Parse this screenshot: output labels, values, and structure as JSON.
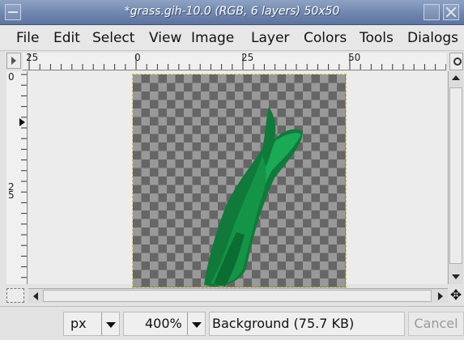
{
  "window": {
    "title": "*grass.gih-10.0 (RGB, 6 layers) 50x50"
  },
  "menubar": {
    "items": [
      "File",
      "Edit",
      "Select",
      "View",
      "Image",
      "Layer",
      "Colors",
      "Tools",
      "Dialogs"
    ]
  },
  "rulers": {
    "horizontal_labels": [
      "25",
      "0",
      "25",
      "50"
    ],
    "vertical_labels": [
      "0",
      "2\n5"
    ]
  },
  "canvas": {
    "checker_dark": "#666666",
    "checker_light": "#999999",
    "grass_colors": [
      "#0f7a3a",
      "#139446",
      "#1aa955",
      "#0c6d33"
    ]
  },
  "statusbar": {
    "unit": "px",
    "zoom": "400%",
    "layer_info": "Background (75.7 KB)",
    "cancel_label": "Cancel"
  },
  "icons": {
    "window_menu": "window-menu-icon",
    "maximize": "maximize-icon",
    "close": "close-icon",
    "navigate": "navigate-icon",
    "quick_mask": "quick-mask-icon",
    "move": "move-icon"
  }
}
